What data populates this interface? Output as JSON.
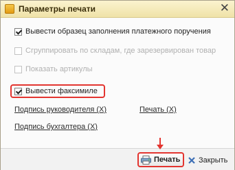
{
  "window": {
    "title": "Параметры печати",
    "close_glyph": "✕"
  },
  "options": [
    {
      "label": "Вывести образец заполнения платежного поручения",
      "checked": true,
      "enabled": true
    },
    {
      "label": "Сгруппировать по складам, где зарезервирован товар",
      "checked": false,
      "enabled": false
    },
    {
      "label": "Показать артикулы",
      "checked": false,
      "enabled": false
    },
    {
      "label": "Вывести факсимиле",
      "checked": true,
      "enabled": true
    }
  ],
  "links": {
    "director_signature": "Подпись руководителя (X)",
    "print_stamp": "Печать (X)",
    "accountant_signature": "Подпись бухгалтера (X)"
  },
  "footer": {
    "print_label": "Печать",
    "close_label": "Закрыть"
  },
  "colors": {
    "highlight": "#e3342f",
    "titlebar": "#f3e7b4"
  }
}
